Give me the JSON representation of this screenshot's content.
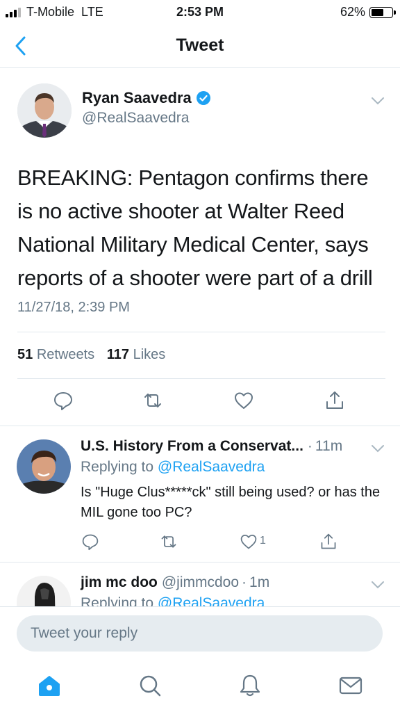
{
  "status_bar": {
    "carrier": "T-Mobile",
    "network": "LTE",
    "time": "2:53 PM",
    "battery_percent": "62%",
    "battery_level": 0.62
  },
  "nav": {
    "title": "Tweet",
    "back_icon": "chevron-left-icon"
  },
  "tweet": {
    "author_name": "Ryan Saavedra",
    "author_handle": "@RealSaavedra",
    "verified": true,
    "text": "BREAKING: Pentagon confirms there is no active shooter at Walter Reed National Military Medical Center, says reports of a shooter were part of a drill",
    "timestamp": "11/27/18, 2:39 PM",
    "retweets_count": "51",
    "retweets_label": "Retweets",
    "likes_count": "117",
    "likes_label": "Likes"
  },
  "replies": [
    {
      "name": "U.S. History From a Conservat...",
      "separator": "·",
      "time": "11m",
      "replying_prefix": "Replying to",
      "replying_to": "@RealSaavedra",
      "text": "Is \"Huge Clus*****ck\" still being used? or has the MIL gone too PC?",
      "like_count": "1"
    },
    {
      "name": "jim mc doo",
      "handle": "@jimmcdoo",
      "separator": "·",
      "time": "1m",
      "replying_prefix": "Replying to",
      "replying_to": "@RealSaavedra"
    }
  ],
  "compose": {
    "placeholder": "Tweet your reply"
  },
  "tabs": [
    "home-icon",
    "search-icon",
    "notifications-icon",
    "messages-icon"
  ],
  "colors": {
    "accent": "#1da1f2",
    "text": "#14171a",
    "secondary": "#657786",
    "divider": "#e1e8ed"
  }
}
